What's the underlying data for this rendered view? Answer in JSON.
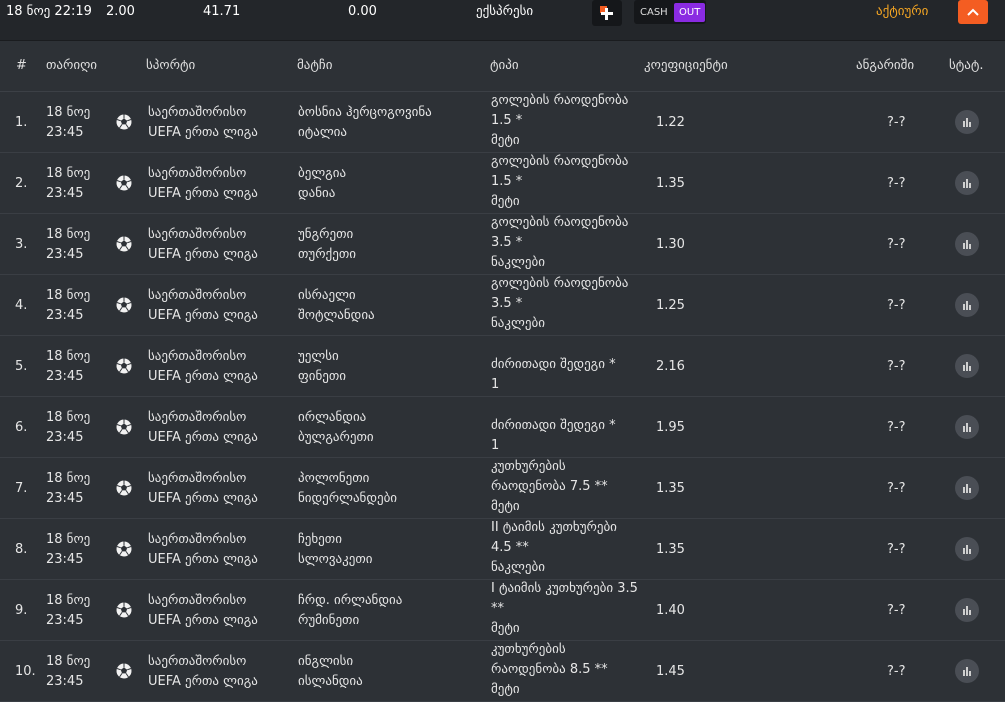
{
  "topbar": {
    "date": "18 ნოე 22:19",
    "stake": "2.00",
    "possible_win": "41.71",
    "returned": "0.00",
    "type": "ექსპრესი",
    "cash_label": "CASH",
    "out_label": "OUT",
    "status": "აქტიური",
    "status_color": "#f5a623",
    "accent_color": "#f45d22",
    "out_color": "#8a2be2"
  },
  "columns": {
    "num": "#",
    "date": "თარიღი",
    "sport": "სპორტი",
    "match": "მატჩი",
    "type": "ტიპი",
    "odds": "კოეფიციენტი",
    "result": "ანგარიში",
    "stats": "სტატ."
  },
  "rows": [
    {
      "num": "1.",
      "day": "18 ნოე",
      "time": "23:45",
      "sport1": "საერთაშორისო",
      "sport2": "UEFA ერთა ლიგა",
      "team1": "ბოსნია ჰერცოგოვინა",
      "team2": "იტალია",
      "type1": "გოლების რაოდენობა",
      "type2": "1.5 *",
      "type3": "მეტი",
      "odds": "1.22",
      "result": "?-?"
    },
    {
      "num": "2.",
      "day": "18 ნოე",
      "time": "23:45",
      "sport1": "საერთაშორისო",
      "sport2": "UEFA ერთა ლიგა",
      "team1": "ბელგია",
      "team2": "დანია",
      "type1": "გოლების რაოდენობა",
      "type2": "1.5 *",
      "type3": "მეტი",
      "odds": "1.35",
      "result": "?-?"
    },
    {
      "num": "3.",
      "day": "18 ნოე",
      "time": "23:45",
      "sport1": "საერთაშორისო",
      "sport2": "UEFA ერთა ლიგა",
      "team1": "უნგრეთი",
      "team2": "თურქეთი",
      "type1": "გოლების რაოდენობა",
      "type2": "3.5 *",
      "type3": "ნაკლები",
      "odds": "1.30",
      "result": "?-?"
    },
    {
      "num": "4.",
      "day": "18 ნოე",
      "time": "23:45",
      "sport1": "საერთაშორისო",
      "sport2": "UEFA ერთა ლიგა",
      "team1": "ისრაელი",
      "team2": "შოტლანდია",
      "type1": "გოლების რაოდენობა",
      "type2": "3.5 *",
      "type3": "ნაკლები",
      "odds": "1.25",
      "result": "?-?"
    },
    {
      "num": "5.",
      "day": "18 ნოე",
      "time": "23:45",
      "sport1": "საერთაშორისო",
      "sport2": "UEFA ერთა ლიგა",
      "team1": "უელსი",
      "team2": "ფინეთი",
      "type1": "",
      "type2": "ძირითადი შედეგი *",
      "type3": "1",
      "odds": "2.16",
      "result": "?-?"
    },
    {
      "num": "6.",
      "day": "18 ნოე",
      "time": "23:45",
      "sport1": "საერთაშორისო",
      "sport2": "UEFA ერთა ლიგა",
      "team1": "ირლანდია",
      "team2": "ბულგარეთი",
      "type1": "",
      "type2": "ძირითადი შედეგი *",
      "type3": "1",
      "odds": "1.95",
      "result": "?-?"
    },
    {
      "num": "7.",
      "day": "18 ნოე",
      "time": "23:45",
      "sport1": "საერთაშორისო",
      "sport2": "UEFA ერთა ლიგა",
      "team1": "პოლონეთი",
      "team2": "ნიდერლანდები",
      "type1": "კუთხურების",
      "type2": "რაოდენობა 7.5 **",
      "type3": "მეტი",
      "odds": "1.35",
      "result": "?-?"
    },
    {
      "num": "8.",
      "day": "18 ნოე",
      "time": "23:45",
      "sport1": "საერთაშორისო",
      "sport2": "UEFA ერთა ლიგა",
      "team1": "ჩეხეთი",
      "team2": "სლოვაკეთი",
      "type1": "II ტაიმის კუთხურები",
      "type2": "4.5 **",
      "type3": "ნაკლები",
      "odds": "1.35",
      "result": "?-?"
    },
    {
      "num": "9.",
      "day": "18 ნოე",
      "time": "23:45",
      "sport1": "საერთაშორისო",
      "sport2": "UEFA ერთა ლიგა",
      "team1": "ჩრდ. ირლანდია",
      "team2": "რუმინეთი",
      "type1": "I ტაიმის კუთხურები 3.5",
      "type2": "**",
      "type3": "მეტი",
      "odds": "1.40",
      "result": "?-?"
    },
    {
      "num": "10.",
      "day": "18 ნოე",
      "time": "23:45",
      "sport1": "საერთაშორისო",
      "sport2": "UEFA ერთა ლიგა",
      "team1": "ინგლისი",
      "team2": "ისლანდია",
      "type1": "კუთხურების",
      "type2": "რაოდენობა 8.5 **",
      "type3": "მეტი",
      "odds": "1.45",
      "result": "?-?"
    }
  ]
}
